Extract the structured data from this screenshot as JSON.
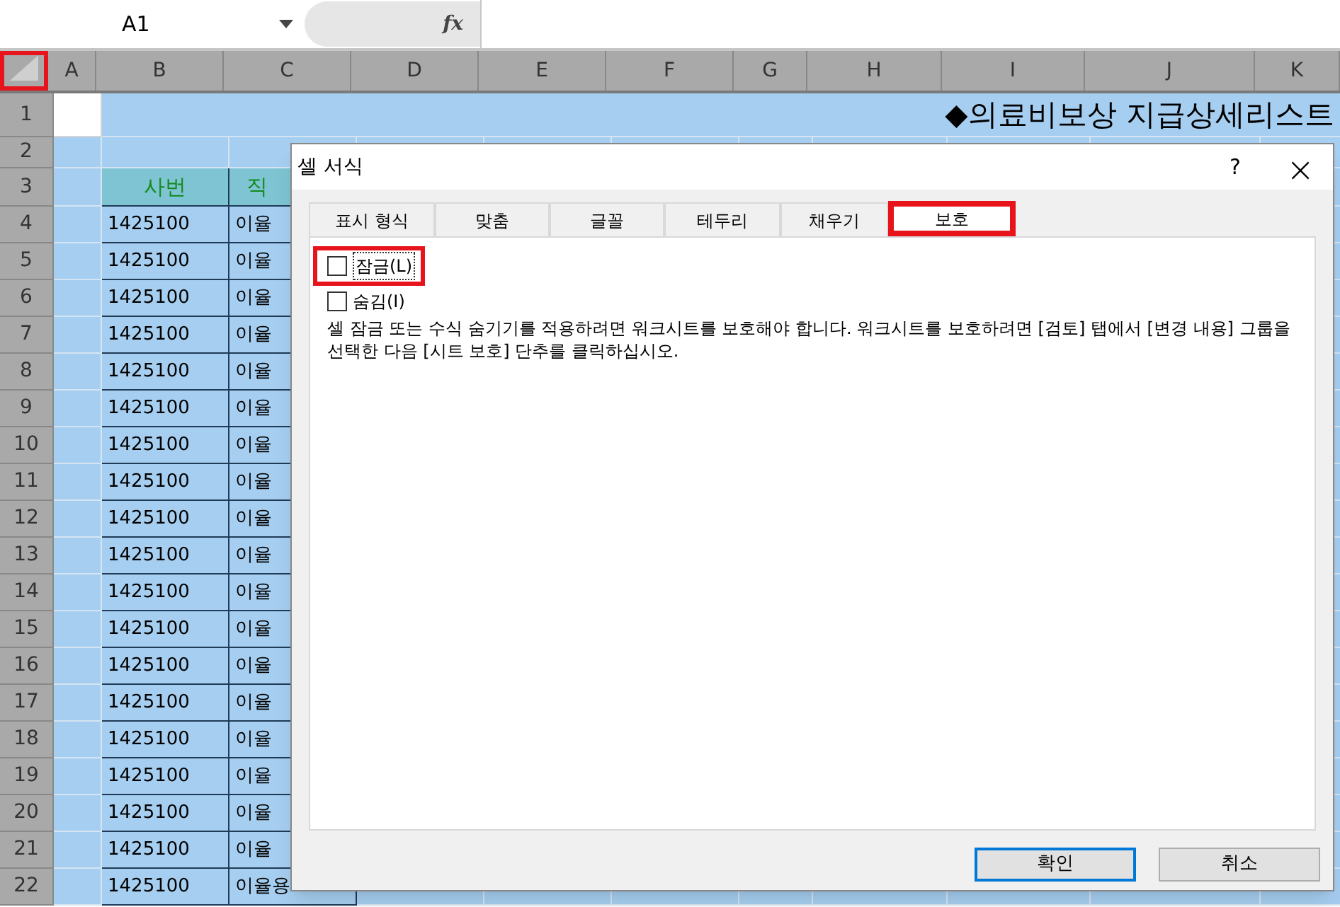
{
  "formula_bar": {
    "name_box": "A1",
    "fx": "fx"
  },
  "columns": [
    "A",
    "B",
    "C",
    "D",
    "E",
    "F",
    "G",
    "H",
    "I",
    "J",
    "K"
  ],
  "title": "◆의료비보상 지급상세리스트",
  "rows": [
    {
      "header": "1",
      "kind": "title"
    },
    {
      "header": "2",
      "kind": "blank"
    },
    {
      "header": "3",
      "kind": "head",
      "cells": {
        "B": "사번",
        "C": "직"
      }
    },
    {
      "header": "4",
      "kind": "data",
      "cells": {
        "B": "1425100",
        "C": "이율"
      }
    },
    {
      "header": "5",
      "kind": "data",
      "cells": {
        "B": "1425100",
        "C": "이율"
      }
    },
    {
      "header": "6",
      "kind": "data",
      "cells": {
        "B": "1425100",
        "C": "이율"
      }
    },
    {
      "header": "7",
      "kind": "data",
      "cells": {
        "B": "1425100",
        "C": "이율"
      }
    },
    {
      "header": "8",
      "kind": "data",
      "cells": {
        "B": "1425100",
        "C": "이율"
      }
    },
    {
      "header": "9",
      "kind": "data",
      "cells": {
        "B": "1425100",
        "C": "이율"
      }
    },
    {
      "header": "10",
      "kind": "data",
      "cells": {
        "B": "1425100",
        "C": "이율"
      }
    },
    {
      "header": "11",
      "kind": "data",
      "cells": {
        "B": "1425100",
        "C": "이율"
      }
    },
    {
      "header": "12",
      "kind": "data",
      "cells": {
        "B": "1425100",
        "C": "이율"
      }
    },
    {
      "header": "13",
      "kind": "data",
      "cells": {
        "B": "1425100",
        "C": "이율"
      }
    },
    {
      "header": "14",
      "kind": "data",
      "cells": {
        "B": "1425100",
        "C": "이율"
      }
    },
    {
      "header": "15",
      "kind": "data",
      "cells": {
        "B": "1425100",
        "C": "이율"
      }
    },
    {
      "header": "16",
      "kind": "data",
      "cells": {
        "B": "1425100",
        "C": "이율"
      }
    },
    {
      "header": "17",
      "kind": "data",
      "cells": {
        "B": "1425100",
        "C": "이율"
      }
    },
    {
      "header": "18",
      "kind": "data",
      "cells": {
        "B": "1425100",
        "C": "이율"
      }
    },
    {
      "header": "19",
      "kind": "data",
      "cells": {
        "B": "1425100",
        "C": "이율"
      }
    },
    {
      "header": "20",
      "kind": "data",
      "cells": {
        "B": "1425100",
        "C": "이율"
      }
    },
    {
      "header": "21",
      "kind": "data",
      "cells": {
        "B": "1425100",
        "C": "이율"
      }
    },
    {
      "header": "22",
      "kind": "data",
      "cells": {
        "B": "1425100",
        "C": "이율용"
      }
    }
  ],
  "dialog": {
    "title": "셀 서식",
    "help": "?",
    "close": "×",
    "tabs": [
      {
        "label": "표시 형식",
        "selected": false
      },
      {
        "label": "맞춤",
        "selected": false
      },
      {
        "label": "글꼴",
        "selected": false
      },
      {
        "label": "테두리",
        "selected": false
      },
      {
        "label": "채우기",
        "selected": false
      },
      {
        "label": "보호",
        "selected": true
      }
    ],
    "options": [
      {
        "label": "잠금(L)",
        "checked": false,
        "highlighted": true
      },
      {
        "label": "숨김(I)",
        "checked": false,
        "highlighted": false
      }
    ],
    "note": "셀 잠금 또는 수식 숨기기를 적용하려면 워크시트를 보호해야 합니다. 워크시트를 보호하려면 [검토] 탭에서 [변경 내용] 그룹을 선택한 다음 [시트 보호] 단추를 클릭하십시오.",
    "buttons": [
      {
        "label": "확인",
        "default": true
      },
      {
        "label": "취소",
        "default": false
      }
    ]
  },
  "select_all": {
    "highlighted": true
  }
}
